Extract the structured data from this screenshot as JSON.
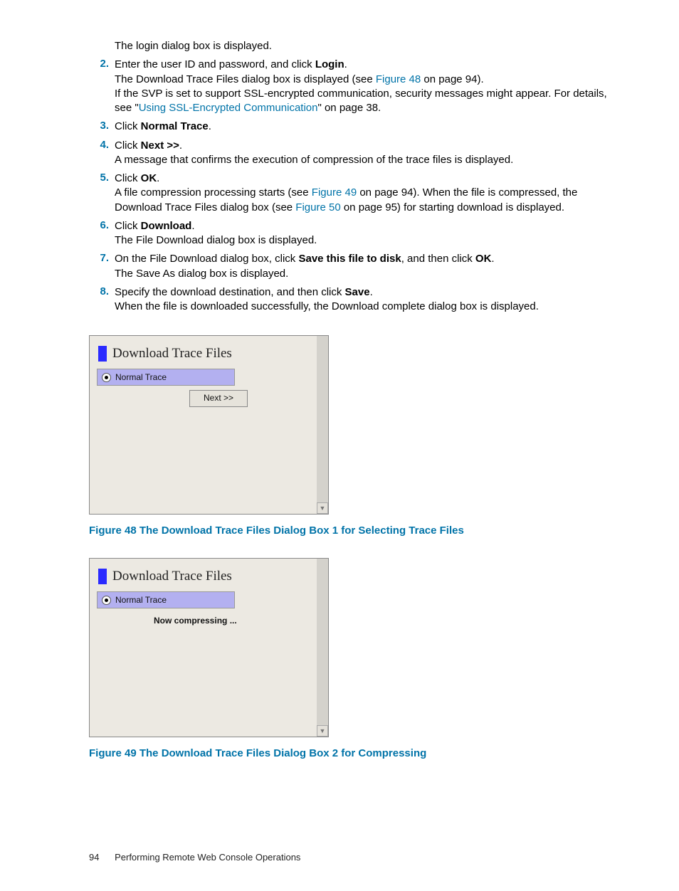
{
  "intro": "The login dialog box is displayed.",
  "steps": [
    {
      "num": "2.",
      "parts": [
        {
          "t": "Enter the user ID and password, and click "
        },
        {
          "t": "Login",
          "b": true
        },
        {
          "t": ".\n"
        },
        {
          "t": "The Download Trace Files dialog box is displayed (see "
        },
        {
          "t": "Figure 48",
          "link": true
        },
        {
          "t": " on page 94).\n"
        },
        {
          "t": "If the SVP is set to support SSL-encrypted communication, security messages might appear. For details, see \""
        },
        {
          "t": "Using SSL-Encrypted Communication",
          "link": true
        },
        {
          "t": "\" on page 38."
        }
      ]
    },
    {
      "num": "3.",
      "parts": [
        {
          "t": "Click "
        },
        {
          "t": "Normal Trace",
          "b": true
        },
        {
          "t": "."
        }
      ]
    },
    {
      "num": "4.",
      "parts": [
        {
          "t": "Click "
        },
        {
          "t": "Next >>",
          "b": true
        },
        {
          "t": ".\n"
        },
        {
          "t": "A message that confirms the execution of compression of the trace files is displayed."
        }
      ]
    },
    {
      "num": "5.",
      "parts": [
        {
          "t": "Click "
        },
        {
          "t": "OK",
          "b": true
        },
        {
          "t": ".\n"
        },
        {
          "t": "A file compression processing starts (see "
        },
        {
          "t": "Figure 49",
          "link": true
        },
        {
          "t": " on page 94). When the file is compressed, the Download Trace Files dialog box (see "
        },
        {
          "t": "Figure 50",
          "link": true
        },
        {
          "t": " on page 95) for starting download is displayed."
        }
      ]
    },
    {
      "num": "6.",
      "parts": [
        {
          "t": "Click "
        },
        {
          "t": "Download",
          "b": true
        },
        {
          "t": ".\n"
        },
        {
          "t": "The File Download dialog box is displayed."
        }
      ]
    },
    {
      "num": "7.",
      "parts": [
        {
          "t": "On the File Download dialog box, click "
        },
        {
          "t": "Save this file to disk",
          "b": true
        },
        {
          "t": ", and then click "
        },
        {
          "t": "OK",
          "b": true
        },
        {
          "t": ".\n"
        },
        {
          "t": "The Save As dialog box is displayed."
        }
      ]
    },
    {
      "num": "8.",
      "parts": [
        {
          "t": "Specify the download destination, and then click "
        },
        {
          "t": "Save",
          "b": true
        },
        {
          "t": ".\n"
        },
        {
          "t": "When the file is downloaded successfully, the Download complete dialog box is displayed."
        }
      ]
    }
  ],
  "dialog1": {
    "title": "Download Trace Files",
    "option": "Normal Trace",
    "button": "Next >>"
  },
  "caption1": "Figure 48 The Download Trace Files Dialog Box 1 for Selecting Trace Files",
  "dialog2": {
    "title": "Download Trace Files",
    "option": "Normal Trace",
    "status": "Now compressing ..."
  },
  "caption2": "Figure 49 The Download Trace Files Dialog Box 2 for Compressing",
  "footer": {
    "page": "94",
    "section": "Performing Remote Web Console Operations"
  }
}
